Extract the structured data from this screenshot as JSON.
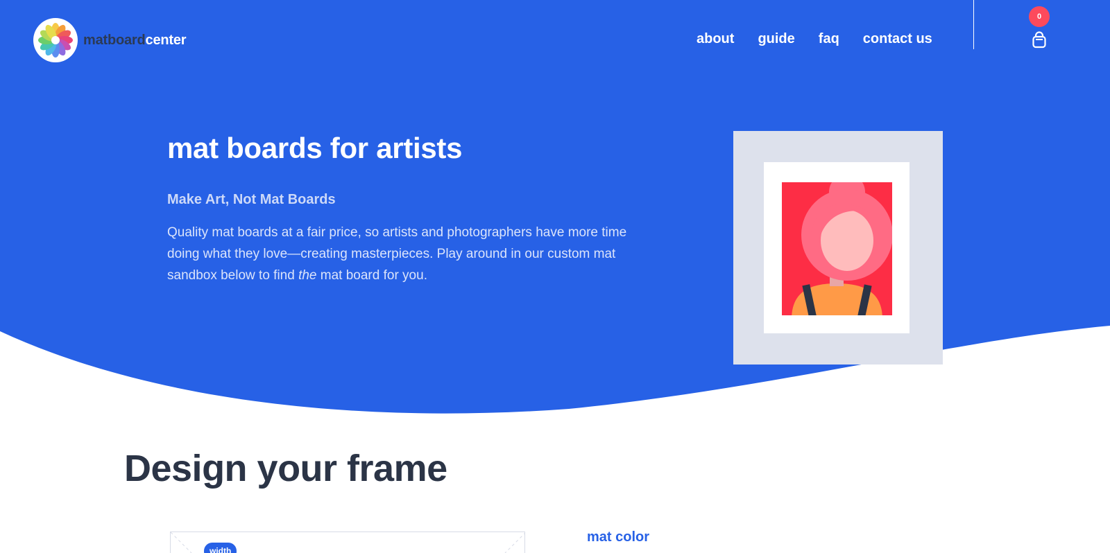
{
  "colors": {
    "brand_blue": "#2761e6",
    "badge_red": "#fd4a5c",
    "heading_dark": "#2b3446",
    "mat_gray": "#dde1ec"
  },
  "header": {
    "logo": {
      "text_dark": "matboard",
      "text_light": "center",
      "icon": "flower-logo-icon"
    },
    "nav": [
      {
        "label": "about"
      },
      {
        "label": "guide"
      },
      {
        "label": "faq"
      },
      {
        "label": "contact us"
      }
    ],
    "cart": {
      "count": "0",
      "icon": "shopping-bag-icon"
    }
  },
  "hero": {
    "title": "mat boards for artists",
    "subtitle": "Make Art, Not Mat Boards",
    "desc_before": "Quality mat boards at a fair price, so artists and photographers have more time doing what they love—creating masterpieces. Play around in our custom mat sandbox below to find ",
    "desc_emphasis": "the",
    "desc_after": " mat board for you.",
    "illustration": "framed-portrait-illustration"
  },
  "design": {
    "title": "Design your frame",
    "width_tag": "width",
    "mat_color_label": "mat color"
  }
}
